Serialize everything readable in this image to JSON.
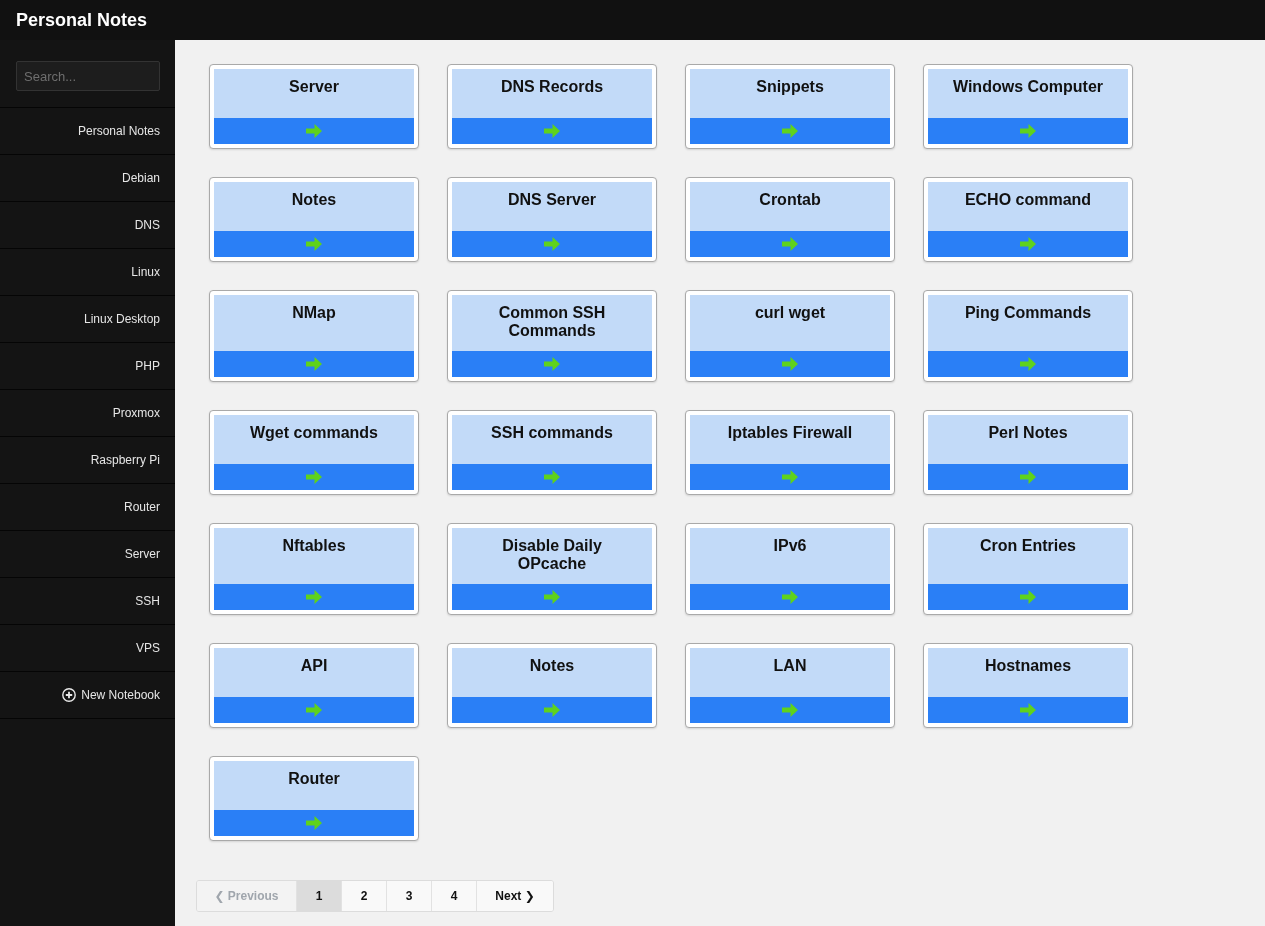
{
  "header": {
    "title": "Personal Notes"
  },
  "sidebar": {
    "search": {
      "placeholder": "Search..."
    },
    "items": [
      {
        "label": "Personal Notes"
      },
      {
        "label": "Debian"
      },
      {
        "label": "DNS"
      },
      {
        "label": "Linux"
      },
      {
        "label": "Linux Desktop"
      },
      {
        "label": "PHP"
      },
      {
        "label": "Proxmox"
      },
      {
        "label": "Raspberry Pi"
      },
      {
        "label": "Router"
      },
      {
        "label": "Server"
      },
      {
        "label": "SSH"
      },
      {
        "label": "VPS"
      }
    ],
    "new_notebook": {
      "label": "New Notebook"
    }
  },
  "notes": [
    {
      "title": "Server"
    },
    {
      "title": "DNS Records"
    },
    {
      "title": "Snippets"
    },
    {
      "title": "Windows Computer"
    },
    {
      "title": "Notes"
    },
    {
      "title": "DNS Server"
    },
    {
      "title": "Crontab"
    },
    {
      "title": "ECHO command"
    },
    {
      "title": "NMap"
    },
    {
      "title": "Common SSH Commands"
    },
    {
      "title": "curl wget"
    },
    {
      "title": "Ping Commands"
    },
    {
      "title": "Wget commands"
    },
    {
      "title": "SSH commands"
    },
    {
      "title": "Iptables Firewall"
    },
    {
      "title": "Perl Notes"
    },
    {
      "title": "Nftables"
    },
    {
      "title": "Disable Daily OPcache"
    },
    {
      "title": "IPv6"
    },
    {
      "title": "Cron Entries"
    },
    {
      "title": "API"
    },
    {
      "title": "Notes"
    },
    {
      "title": "LAN"
    },
    {
      "title": "Hostnames"
    },
    {
      "title": "Router"
    }
  ],
  "pagination": {
    "previous": {
      "label": "❮ Previous",
      "disabled": true
    },
    "pages": [
      {
        "label": "1",
        "selected": true
      },
      {
        "label": "2",
        "selected": false
      },
      {
        "label": "3",
        "selected": false
      },
      {
        "label": "4",
        "selected": false
      }
    ],
    "next": {
      "label": "Next ❯",
      "disabled": false
    }
  }
}
